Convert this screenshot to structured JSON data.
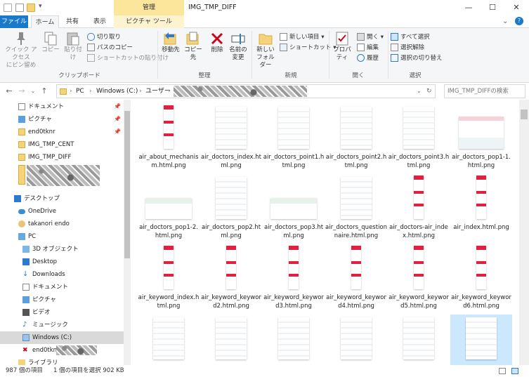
{
  "window": {
    "title": "IMG_TMP_DIFF",
    "context_group": "管理",
    "minimize": "—",
    "maximize": "☐",
    "close": "✕"
  },
  "tabs": {
    "file": "ファイル",
    "home": "ホーム",
    "share": "共有",
    "view": "表示",
    "picture_tools": "ピクチャ ツール"
  },
  "ribbon": {
    "clipboard": {
      "group": "クリップボード",
      "pin": "クイック アクセス\nにピン留め",
      "copy": "コピー",
      "paste": "貼り付け",
      "cut": "切り取り",
      "copy_path": "パスのコピー",
      "paste_shortcut": "ショートカットの貼り付け"
    },
    "organize": {
      "group": "整理",
      "move_to": "移動先",
      "copy_to": "コピー先",
      "delete": "削除",
      "rename": "名前の\n変更"
    },
    "new": {
      "group": "新規",
      "new_folder": "新しい\nフォルダー",
      "new_item": "新しい項目 ▾",
      "shortcut": "ショートカット ▾"
    },
    "open": {
      "group": "開く",
      "properties": "プロパティ",
      "open": "開く ▾",
      "edit": "編集",
      "history": "履歴"
    },
    "select": {
      "group": "選択",
      "select_all": "すべて選択",
      "select_none": "選択解除",
      "invert": "選択の切り替え"
    }
  },
  "address": {
    "crumbs": [
      "PC",
      "Windows (C:)",
      "ユーザー"
    ],
    "search_placeholder": "IMG_TMP_DIFFの検索"
  },
  "nav": {
    "quick_access": [
      {
        "label": "ドキュメント",
        "pinned": true
      },
      {
        "label": "ピクチャ",
        "pinned": true
      },
      {
        "label": "end0tknr",
        "pinned": true
      },
      {
        "label": "IMG_TMP_CENT",
        "pinned": false
      },
      {
        "label": "IMG_TMP_DIFF",
        "pinned": false
      }
    ],
    "pin_glyph": "📌",
    "desktop": "デスクトップ",
    "onedrive": "OneDrive",
    "user": "takanori endo",
    "pc": "PC",
    "pc_items": [
      "3D オブジェクト",
      "Desktop",
      "Downloads",
      "ドキュメント",
      "ピクチャ",
      "ビデオ",
      "ミュージック",
      "Windows (C:)"
    ],
    "network_item": "end0tknr",
    "libraries": "ライブラリ"
  },
  "files": [
    {
      "name": "air_about_mechanism.html.png",
      "shape": "tall-red"
    },
    {
      "name": "air_doctors_index.html.png",
      "shape": "page"
    },
    {
      "name": "air_doctors_point1.html.png",
      "shape": "page"
    },
    {
      "name": "air_doctors_point2.html.png",
      "shape": "page"
    },
    {
      "name": "air_doctors_point3.html.png",
      "shape": "page"
    },
    {
      "name": "air_doctors_pop1-1.html.png",
      "shape": "wide"
    },
    {
      "name": "air_doctors_pop1-2.html.png",
      "shape": "short"
    },
    {
      "name": "air_doctors_pop2.html.png",
      "shape": "page"
    },
    {
      "name": "air_doctors_pop3.html.png",
      "shape": "short"
    },
    {
      "name": "air_doctors_questionnaire.html.png",
      "shape": "page"
    },
    {
      "name": "air_doctors-air_index.html.png",
      "shape": "tall-red"
    },
    {
      "name": "air_index.html.png",
      "shape": "tall-red"
    },
    {
      "name": "air_keyword_index.html.png",
      "shape": "tall-red"
    },
    {
      "name": "air_keyword_keyword2.html.png",
      "shape": "tall-red"
    },
    {
      "name": "air_keyword_keyword3.html.png",
      "shape": "tall-red"
    },
    {
      "name": "air_keyword_keyword4.html.png",
      "shape": "tall-red"
    },
    {
      "name": "air_keyword_keyword5.html.png",
      "shape": "tall-red"
    },
    {
      "name": "air_keyword_keyword6.html.png",
      "shape": "tall-red"
    },
    {
      "name": "",
      "shape": "page"
    },
    {
      "name": "",
      "shape": "page"
    },
    {
      "name": "",
      "shape": "page"
    },
    {
      "name": "",
      "shape": "page"
    },
    {
      "name": "",
      "shape": "page"
    },
    {
      "name": "",
      "shape": "page",
      "selected": true
    }
  ],
  "status": {
    "count": "987 個の項目",
    "selection": "1 個の項目を選択  902 KB"
  }
}
